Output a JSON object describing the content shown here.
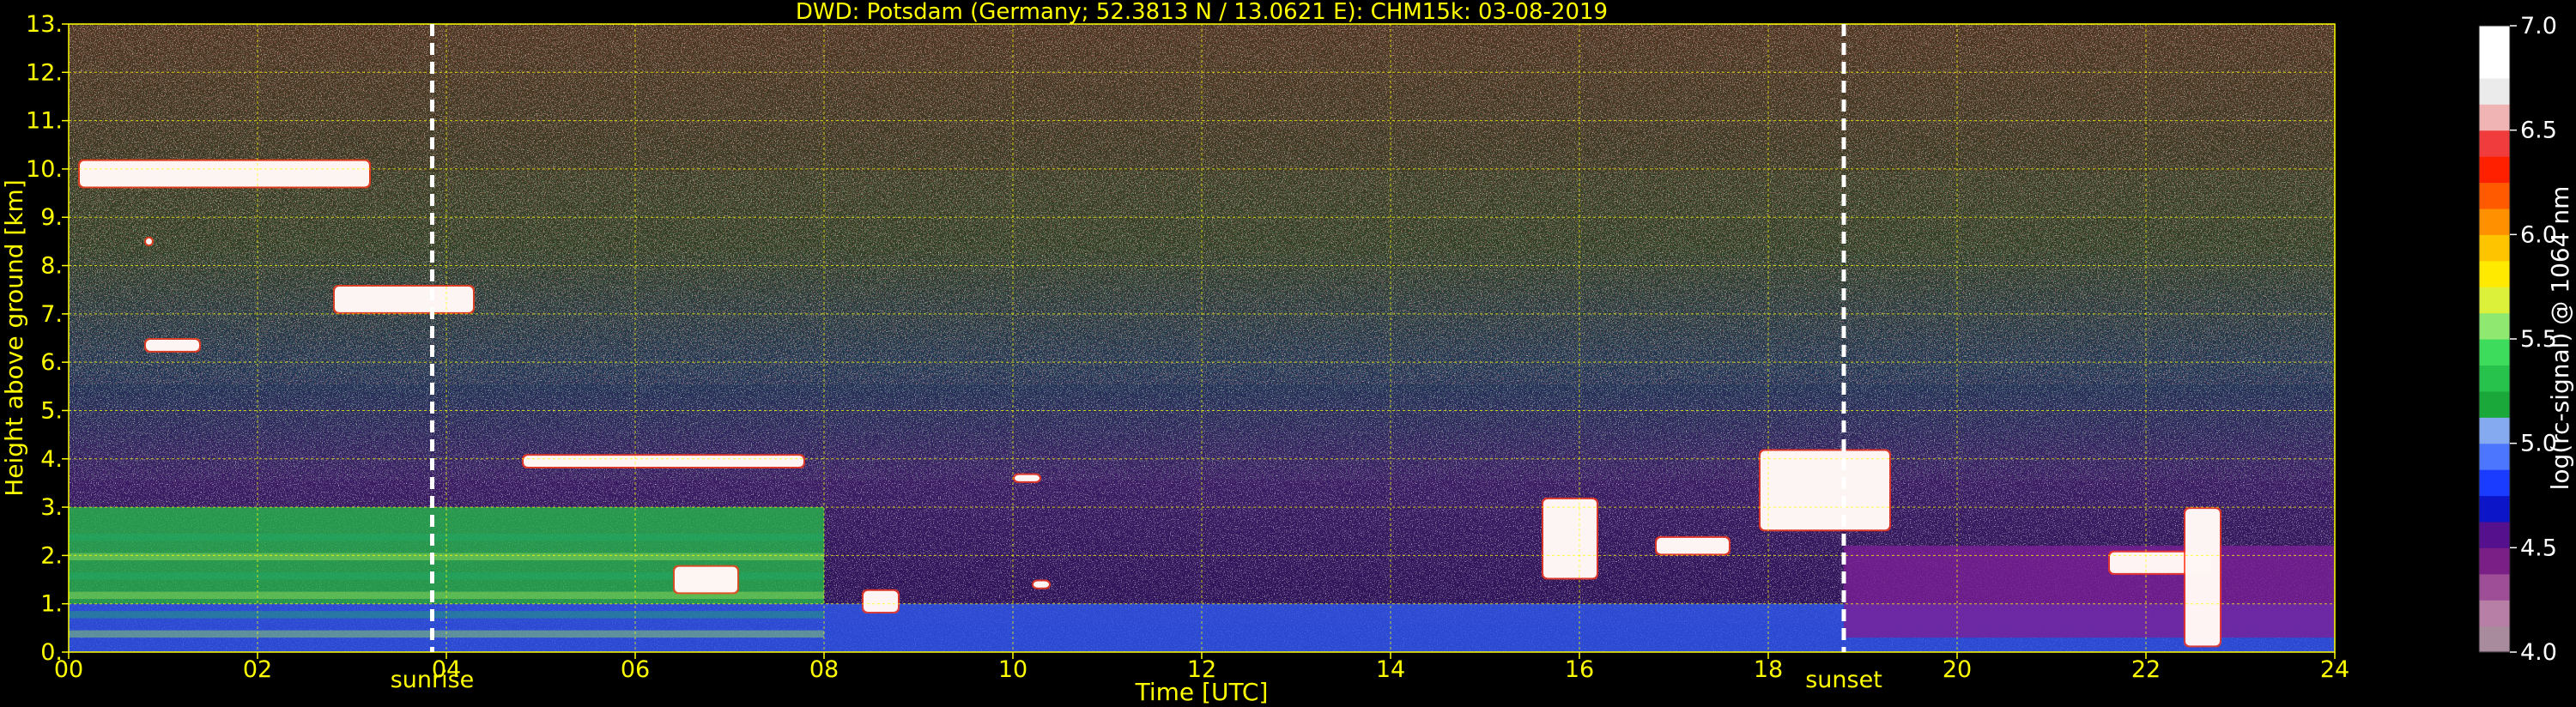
{
  "chart_data": {
    "type": "heatmap",
    "title": "DWD: Potsdam (Germany; 52.3813 N / 13.0621 E):    CHM15k: 03-08-2019",
    "xlabel": "Time [UTC]",
    "ylabel": "Height above ground [km]",
    "xlim": [
      0,
      24
    ],
    "ylim": [
      0,
      13
    ],
    "x_ticks": [
      "00",
      "02",
      "04",
      "06",
      "08",
      "10",
      "12",
      "14",
      "16",
      "18",
      "20",
      "22",
      "24"
    ],
    "y_ticks": [
      "0.",
      "1.",
      "2.",
      "3.",
      "4.",
      "5.",
      "6.",
      "7.",
      "8.",
      "9.",
      "10.",
      "11.",
      "12.",
      "13."
    ],
    "grid": true,
    "grid_color": "#ffff00",
    "colorbar": {
      "label": "log(rc-signal) @ 1064 nm",
      "range": [
        4.0,
        7.0
      ],
      "ticks": [
        "4.0",
        "4.5",
        "5.0",
        "5.5",
        "6.0",
        "6.5",
        "7.0"
      ],
      "colors": [
        "#a98b9e",
        "#b87fa6",
        "#9d4e96",
        "#7a1f85",
        "#55108e",
        "#0c16c8",
        "#1a3cff",
        "#4d76ff",
        "#86aaf0",
        "#1aa83a",
        "#27c24b",
        "#3ddc5c",
        "#8fe870",
        "#dcf23a",
        "#ffea00",
        "#ffc400",
        "#ff9000",
        "#ff5a00",
        "#ff2000",
        "#f03c3c",
        "#f0b4b4",
        "#ebebeb",
        "#ffffff",
        "#ffffff"
      ]
    },
    "events": [
      {
        "label": "sunrise",
        "time": 3.85
      },
      {
        "label": "sunset",
        "time": 18.8
      }
    ],
    "layers": [
      {
        "kind": "boundary_layer",
        "time_range": [
          0,
          24
        ],
        "height_km": [
          0,
          1.0
        ]
      },
      {
        "kind": "aerosol_layer",
        "time_range": [
          0,
          8
        ],
        "height_km": [
          1.0,
          3.0
        ]
      },
      {
        "kind": "residual_layer",
        "time_range": [
          18.8,
          24
        ],
        "height_km": [
          0.3,
          2.2
        ]
      }
    ],
    "clouds": [
      {
        "time_range": [
          0.1,
          3.2
        ],
        "height_km": [
          9.6,
          10.2
        ]
      },
      {
        "time_range": [
          0.8,
          0.9
        ],
        "height_km": [
          8.4,
          8.6
        ]
      },
      {
        "time_range": [
          2.8,
          4.3
        ],
        "height_km": [
          7.0,
          7.6
        ]
      },
      {
        "time_range": [
          0.8,
          1.4
        ],
        "height_km": [
          6.2,
          6.5
        ]
      },
      {
        "time_range": [
          4.8,
          7.8
        ],
        "height_km": [
          3.8,
          4.1
        ]
      },
      {
        "time_range": [
          10.0,
          10.3
        ],
        "height_km": [
          3.5,
          3.7
        ]
      },
      {
        "time_range": [
          17.9,
          19.3
        ],
        "height_km": [
          2.5,
          4.2
        ]
      },
      {
        "time_range": [
          15.6,
          16.2
        ],
        "height_km": [
          1.5,
          3.2
        ]
      },
      {
        "time_range": [
          16.8,
          17.6
        ],
        "height_km": [
          2.0,
          2.4
        ]
      },
      {
        "time_range": [
          21.6,
          22.7
        ],
        "height_km": [
          1.6,
          2.1
        ]
      },
      {
        "time_range": [
          22.4,
          22.8
        ],
        "height_km": [
          0.1,
          3.0
        ]
      },
      {
        "time_range": [
          6.4,
          7.1
        ],
        "height_km": [
          1.2,
          1.8
        ]
      },
      {
        "time_range": [
          8.4,
          8.8
        ],
        "height_km": [
          0.8,
          1.3
        ]
      },
      {
        "time_range": [
          10.2,
          10.4
        ],
        "height_km": [
          1.3,
          1.5
        ]
      }
    ]
  }
}
